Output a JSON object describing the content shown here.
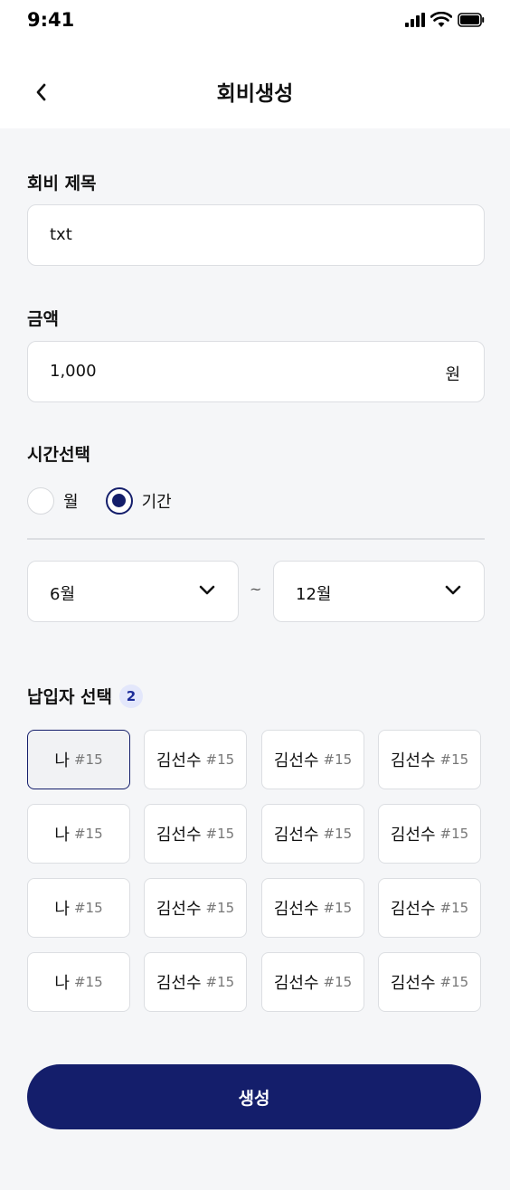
{
  "status_bar": {
    "time": "9:41"
  },
  "header": {
    "title": "회비생성"
  },
  "form": {
    "title_label": "회비 제목",
    "title_value": "txt",
    "amount_label": "금액",
    "amount_value": "1,000",
    "amount_unit": "원",
    "time_label": "시간선택",
    "time_options": [
      {
        "label": "월",
        "checked": false
      },
      {
        "label": "기간",
        "checked": true
      }
    ],
    "range_start": "6월",
    "range_separator": "~",
    "range_end": "12월"
  },
  "payers": {
    "label": "납입자 선택",
    "count": "2",
    "rows": [
      [
        {
          "name": "나",
          "number": "#15",
          "selected": true
        },
        {
          "name": "김선수",
          "number": "#15",
          "selected": false
        },
        {
          "name": "김선수",
          "number": "#15",
          "selected": false
        },
        {
          "name": "김선수",
          "number": "#15",
          "selected": false
        }
      ],
      [
        {
          "name": "나",
          "number": "#15",
          "selected": false
        },
        {
          "name": "김선수",
          "number": "#15",
          "selected": false
        },
        {
          "name": "김선수",
          "number": "#15",
          "selected": false
        },
        {
          "name": "김선수",
          "number": "#15",
          "selected": false
        }
      ],
      [
        {
          "name": "나",
          "number": "#15",
          "selected": false
        },
        {
          "name": "김선수",
          "number": "#15",
          "selected": false
        },
        {
          "name": "김선수",
          "number": "#15",
          "selected": false
        },
        {
          "name": "김선수",
          "number": "#15",
          "selected": false
        }
      ],
      [
        {
          "name": "나",
          "number": "#15",
          "selected": false
        },
        {
          "name": "김선수",
          "number": "#15",
          "selected": false
        },
        {
          "name": "김선수",
          "number": "#15",
          "selected": false
        },
        {
          "name": "김선수",
          "number": "#15",
          "selected": false
        }
      ]
    ]
  },
  "submit_label": "생성",
  "icons": {
    "back": "chevron-left-icon",
    "dropdown": "chevron-down-icon",
    "signal": "signal-icon",
    "wifi": "wifi-icon",
    "battery": "battery-icon"
  },
  "colors": {
    "primary": "#141e6b",
    "background": "#f5f6f8",
    "badge_bg": "#e3e7fb"
  }
}
